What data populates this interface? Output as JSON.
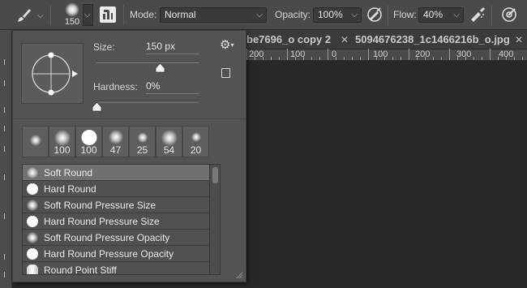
{
  "options_bar": {
    "brush_size_preview": "150",
    "mode_label": "Mode:",
    "mode_value": "Normal",
    "opacity_label": "Opacity:",
    "opacity_value": "100%",
    "flow_label": "Flow:",
    "flow_value": "40%"
  },
  "tabs": [
    {
      "label": "be7696_o copy 2"
    },
    {
      "label": "5094676238_1c1466216b_o.jpg"
    }
  ],
  "ruler": {
    "labels": [
      "200",
      "100",
      "0",
      "100",
      "200",
      "300",
      "400"
    ]
  },
  "brush_panel": {
    "size_label": "Size:",
    "size_value": "150 px",
    "hardness_label": "Hardness:",
    "hardness_value": "0%",
    "size_fraction": 0.62,
    "hardness_fraction": 0.0,
    "tips": [
      {
        "label": ""
      },
      {
        "label": "100"
      },
      {
        "label": "100"
      },
      {
        "label": "47"
      },
      {
        "label": "25"
      },
      {
        "label": "54"
      },
      {
        "label": "20"
      }
    ],
    "presets": [
      {
        "name": "Soft Round",
        "icon": "soft-round-icon",
        "selected": true
      },
      {
        "name": "Hard Round",
        "icon": "hard-round-icon",
        "selected": false
      },
      {
        "name": "Soft Round Pressure Size",
        "icon": "soft-round-icon",
        "selected": false
      },
      {
        "name": "Hard Round Pressure Size",
        "icon": "hard-round-icon",
        "selected": false
      },
      {
        "name": "Soft Round Pressure Opacity",
        "icon": "soft-round-icon",
        "selected": false
      },
      {
        "name": "Hard Round Pressure Opacity",
        "icon": "hard-round-icon",
        "selected": false
      },
      {
        "name": "Round Point Stiff",
        "icon": "stiff-brush-icon",
        "selected": false
      }
    ]
  },
  "colors": {
    "panel_bg": "#535353",
    "toolbar_bg": "#4a4a4a",
    "canvas_bg": "#282828",
    "selection": "#707070"
  }
}
